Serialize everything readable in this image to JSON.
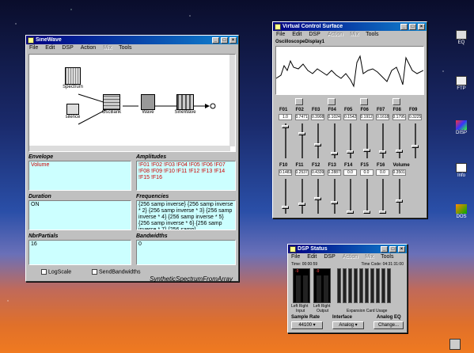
{
  "sinewave": {
    "title": "SineWave",
    "menu": [
      "File",
      "Edit",
      "DSP",
      "Action",
      "Mix",
      "Tools"
    ],
    "menu_disabled": [
      false,
      false,
      false,
      false,
      true,
      false
    ],
    "nodes": {
      "spectrum": "Spectrum",
      "silence": "silence",
      "oscbank": "OscBank",
      "wave": "Wave",
      "sinewave": "SineWave"
    },
    "envelope_label": "Envelope",
    "envelope_value": "Volume",
    "amplitudes_label": "Amplitudes",
    "amplitudes_value": "!F01 !F02 !F03 !F04 !F05 !F06 !F07 !F08 !F09 !F10 !F11 !F12 !F13 !F14 !F15 !F16",
    "duration_label": "Duration",
    "duration_value": "ON",
    "frequencies_label": "Frequencies",
    "frequencies_value": "{256 samp inverse} {256 samp inverse * 2} {256 samp inverse * 3} {256 samp inverse * 4} {256 samp inverse * 5} {256 samp inverse * 6} {256 samp inverse * 7} {256 samp}",
    "nbrpartials_label": "NbrPartials",
    "nbrpartials_value": "16",
    "bandwidths_label": "Bandwidths",
    "bandwidths_value": "0",
    "logscale_label": "LogScale",
    "sendbandwidths_label": "SendBandwidths",
    "footer": "SyntheticSpectrumFromArray"
  },
  "vcs": {
    "title": "Virtual Control Surface",
    "menu": [
      "File",
      "Edit",
      "DSP",
      "Action",
      "Mix",
      "Tools"
    ],
    "menu_disabled": [
      false,
      false,
      false,
      true,
      true,
      false
    ],
    "scope_label": "OscilloscopeDisplay1",
    "row1_headers": [
      "F01",
      "F02",
      "F03",
      "F04",
      "F05",
      "F06",
      "F07",
      "F08",
      "F09"
    ],
    "row1_values": [
      "1.0",
      "0.7471",
      "0.3908",
      "0.1024",
      "0.1542",
      "0.1912",
      "0.1618",
      "0.1795",
      "0.3225"
    ],
    "row1_levels": [
      0.95,
      0.72,
      0.38,
      0.1,
      0.15,
      0.19,
      0.16,
      0.18,
      0.32
    ],
    "row2_headers": [
      "F10",
      "F11",
      "F12",
      "F13",
      "F14",
      "F15",
      "F16",
      "Volume"
    ],
    "row2_values": [
      "0.1483",
      "0.2537",
      "0.4339",
      "0.2887",
      "0.0",
      "0.0",
      "0.0",
      "0.3501"
    ],
    "row2_levels": [
      0.15,
      0.25,
      0.43,
      0.29,
      0.0,
      0.0,
      0.0,
      0.35
    ]
  },
  "dsp": {
    "title": "DSP Status",
    "menu": [
      "File",
      "Edit",
      "DSP",
      "Action",
      "Mix",
      "Tools"
    ],
    "menu_disabled": [
      false,
      false,
      false,
      true,
      true,
      false
    ],
    "time_label": "Time: 00:00:59",
    "timecode_label": "Time Code: 04:31:31:00",
    "input_label": "Input",
    "output_label": "Output",
    "left1": "Left",
    "right1": "Right",
    "left2": "Left",
    "right2": "Right",
    "expansion_label": "Expansion Card Usage",
    "input_peak": "-9",
    "output_peak": "-9",
    "sample_rate_label": "Sample Rate",
    "sample_rate_value": "44100",
    "interface_label": "Interface",
    "interface_value": "Analog",
    "analog_eq_label": "Analog EQ",
    "change_label": "Change..."
  },
  "desktop": {
    "icons": [
      "EQ",
      "FTP",
      "DISP",
      "Info",
      "DOS"
    ]
  },
  "colors": {
    "title_active": "#000080",
    "cyan": "#ccffff",
    "red_text": "#cc0000"
  }
}
